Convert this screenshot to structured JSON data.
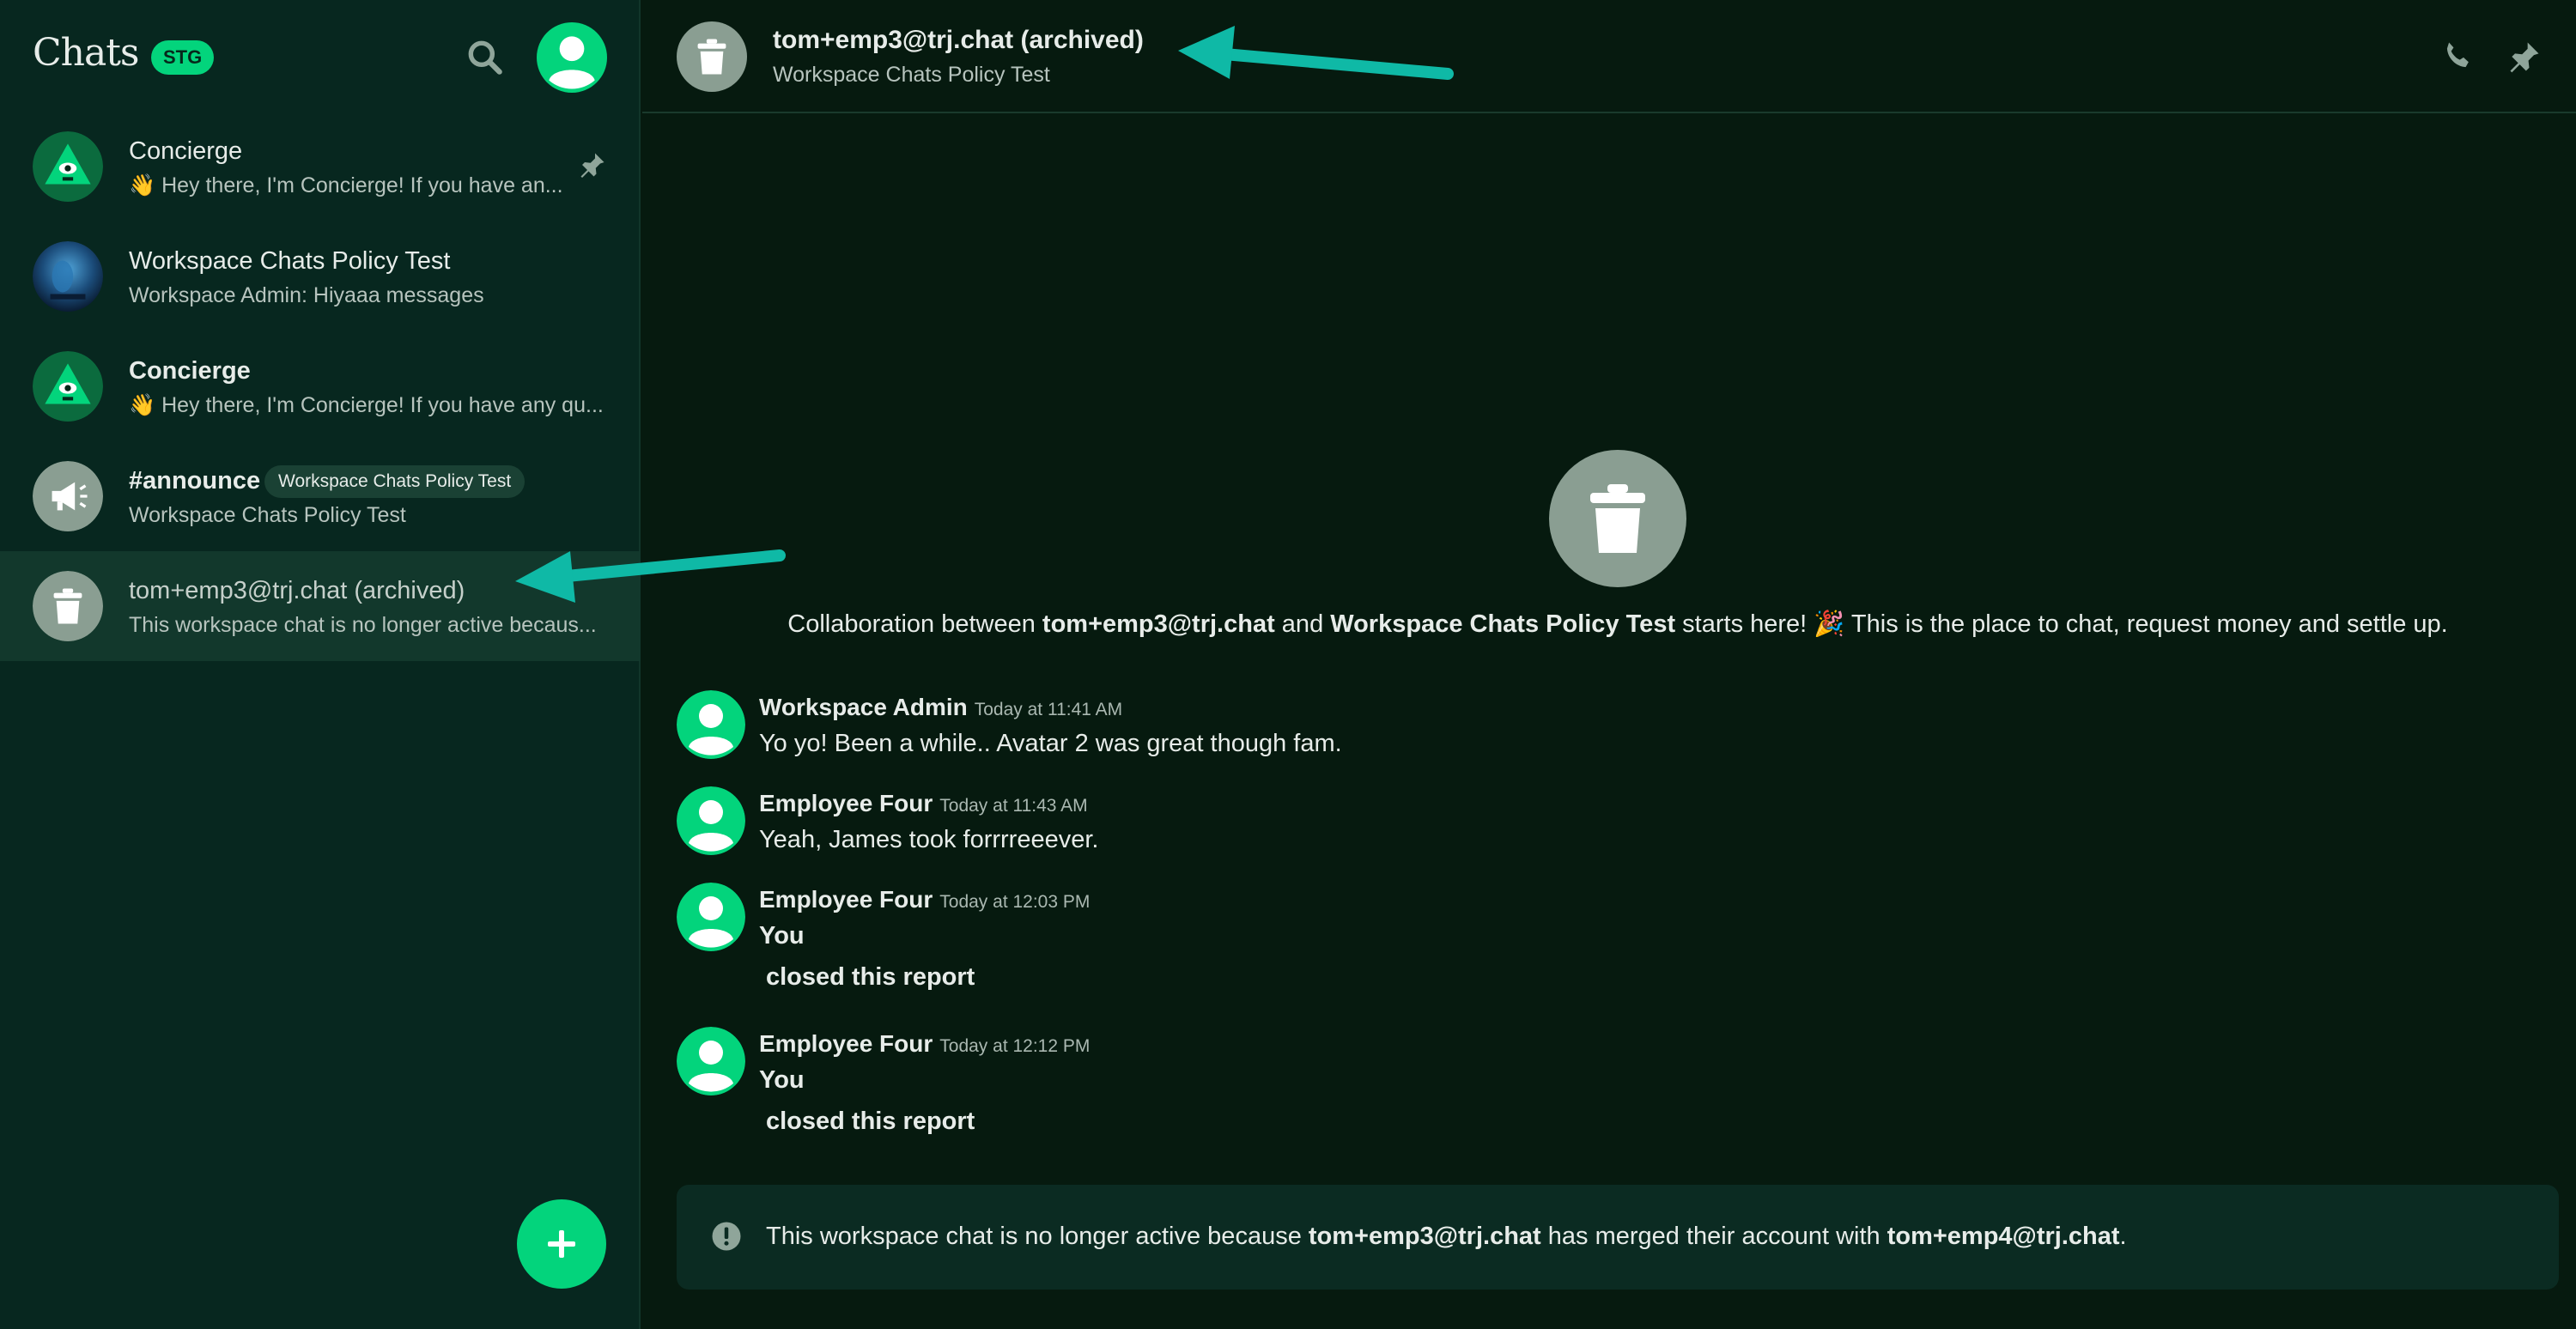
{
  "sidebar": {
    "title": "Chats",
    "env_badge": "STG",
    "chats": [
      {
        "name": "Concierge",
        "preview": "👋 Hey there, I'm Concierge! If you have an...",
        "pinned": true
      },
      {
        "name": "Workspace Chats Policy Test",
        "preview": "Workspace Admin: Hiyaaa messages"
      },
      {
        "name": "Concierge",
        "preview": "👋 Hey there, I'm Concierge! If you have any qu..."
      },
      {
        "name": "#announce",
        "badge": "Workspace Chats Policy Test",
        "preview": "Workspace Chats Policy Test"
      },
      {
        "name": "tom+emp3@trj.chat (archived)",
        "preview": "This workspace chat is no longer active becaus..."
      }
    ]
  },
  "header": {
    "title": "tom+emp3@trj.chat (archived)",
    "subtitle": "Workspace Chats Policy Test"
  },
  "intro": {
    "prefix": "Collaboration between ",
    "user": "tom+emp3@trj.chat",
    "and": " and ",
    "workspace": "Workspace Chats Policy Test",
    "suffix": " starts here! 🎉 This is the place to chat, request money and settle up."
  },
  "messages": [
    {
      "author": "Workspace Admin",
      "time": "Today at 11:41 AM",
      "text": "Yo yo! Been a while.. Avatar 2 was great though fam."
    },
    {
      "author": "Employee Four",
      "time": "Today at 11:43 AM",
      "text": "Yeah, James took forrrreeever."
    },
    {
      "author": "Employee Four",
      "time": "Today at 12:03 PM",
      "text": "You",
      "text2": "closed this report"
    },
    {
      "author": "Employee Four",
      "time": "Today at 12:12 PM",
      "text": "You",
      "text2": "closed this report"
    }
  ],
  "banner": {
    "prefix": "This workspace chat is no longer active because ",
    "old_account": "tom+emp3@trj.chat",
    "middle": " has merged their account with ",
    "new_account": "tom+emp4@trj.chat",
    "suffix": "."
  },
  "colors": {
    "accent": "#03d47c",
    "sidebar_bg": "#07271f",
    "main_bg": "#061a0f",
    "arrow": "#0fb9a6"
  },
  "icons": [
    "search-icon",
    "user-avatar-icon",
    "pin-icon",
    "phone-icon",
    "trash-icon",
    "megaphone-icon",
    "plus-icon",
    "exclamation-icon",
    "concierge-icon"
  ]
}
